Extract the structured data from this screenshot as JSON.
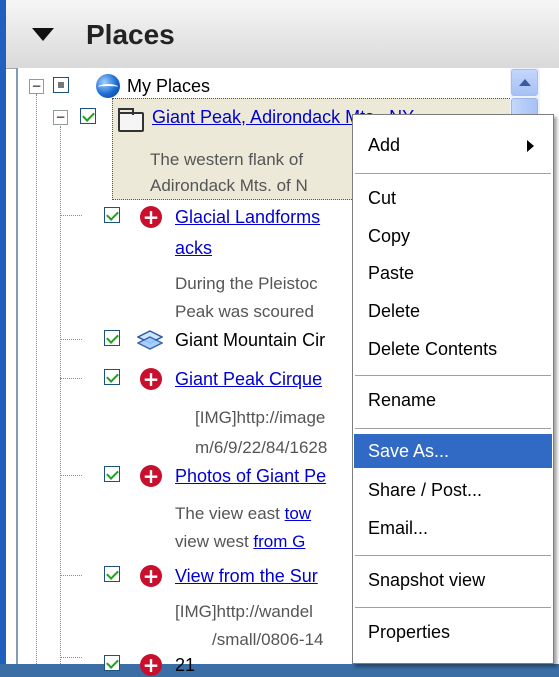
{
  "panel": {
    "title": "Places"
  },
  "tree": {
    "root": "My Places",
    "selected_item": "Giant Peak, Adirondack Mts., NY",
    "selected_desc": [
      "The western flank of",
      "Adirondack Mts. of N"
    ],
    "items": [
      {
        "title_line1": "Glacial Landforms",
        "title_line2": "acks",
        "desc": [
          "During the Pleistoc",
          "Peak was scoured"
        ]
      },
      {
        "title": "Giant Mountain Cir"
      },
      {
        "title": "Giant Peak Cirque",
        "desc": [
          "[IMG]http://image",
          "m/6/9/22/84/1628"
        ]
      },
      {
        "title": "Photos of Giant Pe",
        "desc_pre1": "The view east ",
        "desc_link1": "tow",
        "desc_pre2": "view west ",
        "desc_link2": "from G"
      },
      {
        "title": "View from the Sur",
        "desc": [
          "[IMG]http://wandel",
          "/small/0806-14"
        ]
      },
      {
        "title": "21"
      }
    ]
  },
  "context_menu": {
    "items": [
      "Add",
      "Cut",
      "Copy",
      "Paste",
      "Delete",
      "Delete Contents",
      "Rename",
      "Save As...",
      "Share / Post...",
      "Email...",
      "Snapshot view",
      "Properties"
    ],
    "highlighted": "Save As..."
  },
  "icons": {
    "header_toggle": "triangle-down-icon",
    "root": "globe-icon",
    "folder": "folder-icon",
    "placemark": "red-plus-icon",
    "layer": "layers-icon"
  },
  "colors": {
    "selection": "#316ac5",
    "link": "#0000d4",
    "placemark": "#c8102e"
  }
}
